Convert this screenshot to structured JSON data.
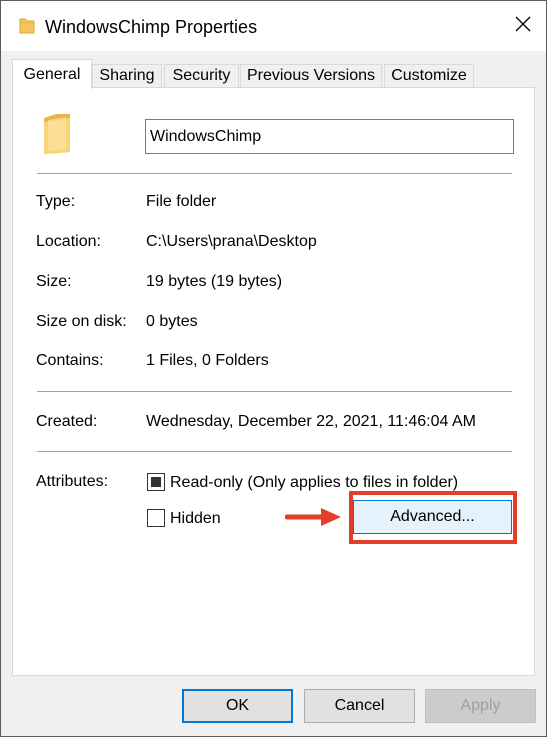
{
  "window": {
    "title": "WindowsChimp Properties"
  },
  "tabs": [
    {
      "label": "General",
      "active": true
    },
    {
      "label": "Sharing",
      "active": false
    },
    {
      "label": "Security",
      "active": false
    },
    {
      "label": "Previous Versions",
      "active": false
    },
    {
      "label": "Customize",
      "active": false
    }
  ],
  "general": {
    "name_value": "WindowsChimp",
    "type": {
      "label": "Type:",
      "value": "File folder"
    },
    "location": {
      "label": "Location:",
      "value": "C:\\Users\\prana\\Desktop"
    },
    "size": {
      "label": "Size:",
      "value": "19 bytes (19 bytes)"
    },
    "size_on_disk": {
      "label": "Size on disk:",
      "value": "0 bytes"
    },
    "contains": {
      "label": "Contains:",
      "value": "1 Files, 0 Folders"
    },
    "created": {
      "label": "Created:",
      "value": "Wednesday, December 22, 2021, 11:46:04 AM"
    },
    "attributes": {
      "label": "Attributes:",
      "readonly_label": "Read-only (Only applies to files in folder)",
      "readonly_state": "indeterminate",
      "hidden_label": "Hidden",
      "hidden_state": "unchecked",
      "advanced_label": "Advanced..."
    }
  },
  "buttons": {
    "ok": "OK",
    "cancel": "Cancel",
    "apply": "Apply"
  },
  "icons": {
    "title": "folder-icon",
    "close": "close-icon",
    "folder_large": "folder-icon",
    "annotation": "arrow-right-icon"
  },
  "colors": {
    "accent": "#0078d7",
    "highlight": "#e43e2b",
    "folder": "#f5c65b"
  }
}
